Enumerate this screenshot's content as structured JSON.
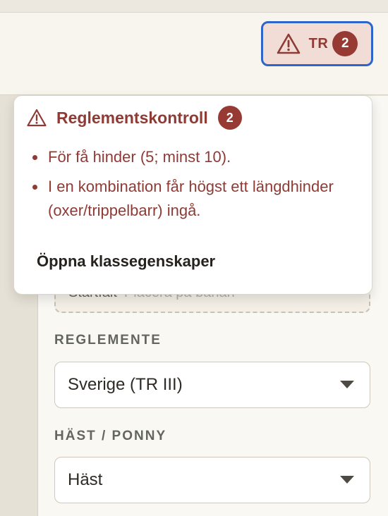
{
  "header": {
    "tr_button": {
      "icon": "warning-triangle-icon",
      "label": "TR",
      "count": "2"
    }
  },
  "form": {
    "start_field": {
      "label": "Startfält",
      "placeholder": "Placera på banan"
    },
    "reglemente": {
      "label": "REGLEMENTE",
      "value": "Sverige (TR III)"
    },
    "hast_ponny": {
      "label": "HÄST / PONNY",
      "value": "Häst"
    }
  },
  "popover": {
    "icon": "warning-triangle-icon",
    "title": "Reglementskontroll",
    "count": "2",
    "issues": [
      "För få hinder (5; minst 10).",
      "I en kombination får högst ett längdhinder (oxer/trippelbarr) ingå."
    ],
    "action_label": "Öppna klassegenskaper"
  },
  "colors": {
    "accent_red": "#8f3b35",
    "badge_red": "#963a33",
    "focus_blue": "#2f64c8",
    "panel_bg": "#faf8f3"
  }
}
